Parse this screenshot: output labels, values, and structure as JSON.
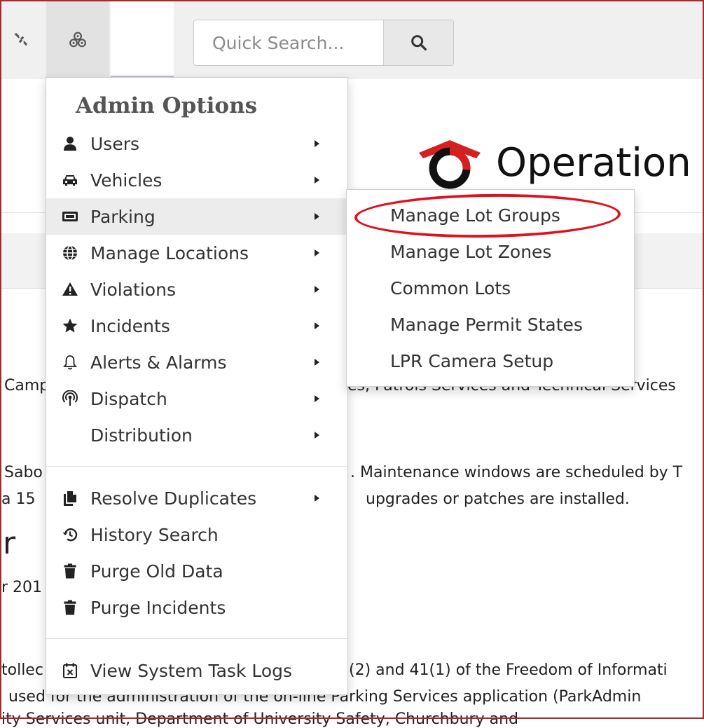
{
  "search": {
    "placeholder": "Quick Search..."
  },
  "page": {
    "title": "Operation",
    "lines": [
      "Camp",
      "es, Patrols Services and Technical Services",
      "Sabo",
      ". Maintenance windows are scheduled by T",
      "a 15",
      "upgrades or patches are installed.",
      "r",
      "r 201",
      "tollec",
      "(2) and 41(1) of the Freedom of Informati",
      "used for the administration of the on-line Parking Services application (ParkAdmin",
      "ity Services unit, Department of University Safety, Churchbury and"
    ]
  },
  "admin_menu": {
    "header": "Admin Options",
    "items": [
      {
        "label": "Users",
        "icon": "user-icon"
      },
      {
        "label": "Vehicles",
        "icon": "car-icon"
      },
      {
        "label": "Parking",
        "icon": "parking-sign-icon"
      },
      {
        "label": "Manage Locations",
        "icon": "globe-icon"
      },
      {
        "label": "Violations",
        "icon": "warning-icon"
      },
      {
        "label": "Incidents",
        "icon": "star-icon"
      },
      {
        "label": "Alerts & Alarms",
        "icon": "bell-icon"
      },
      {
        "label": "Dispatch",
        "icon": "broadcast-icon"
      },
      {
        "label": "Distribution",
        "icon": ""
      },
      {
        "label": "Resolve Duplicates",
        "icon": "copy-icon"
      },
      {
        "label": "History Search",
        "icon": "history-icon"
      },
      {
        "label": "Purge Old Data",
        "icon": "trash-icon"
      },
      {
        "label": "Purge Incidents",
        "icon": "trash-icon"
      },
      {
        "label": "View System Task Logs",
        "icon": "task-log-icon"
      }
    ]
  },
  "parking_submenu": {
    "items": [
      "Manage Lot Groups",
      "Manage Lot Zones",
      "Common Lots",
      "Manage Permit States",
      "LPR Camera Setup"
    ]
  },
  "colors": {
    "highlight": "#e0101c",
    "logo_red": "#d42020",
    "frame": "#a52a2a"
  }
}
